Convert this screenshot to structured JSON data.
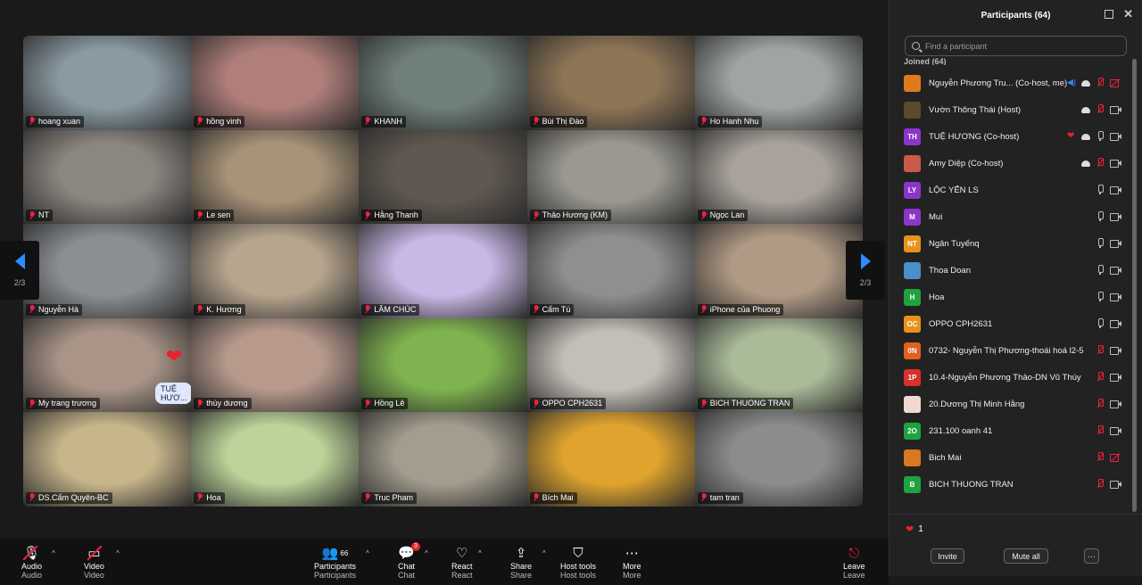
{
  "stage": {
    "pager_left": {
      "page": "2/3"
    },
    "pager_right": {
      "page": "2/3"
    },
    "tiles": [
      {
        "name": "hoang xuan",
        "bg": "#8a9aa3"
      },
      {
        "name": "hồng vinh",
        "bg": "#b07f7a"
      },
      {
        "name": "KHANH",
        "bg": "#6f7f7a"
      },
      {
        "name": "Bùi Thị Đào",
        "bg": "#8e7556"
      },
      {
        "name": "Ho Hanh Nhu",
        "bg": "#9fa6a1"
      },
      {
        "name": "NT",
        "bg": "#8c8680"
      },
      {
        "name": "Le sen",
        "bg": "#a89378"
      },
      {
        "name": "Hằng Thanh",
        "bg": "#5f5850"
      },
      {
        "name": "Thảo Hương (KM)",
        "bg": "#9a9891"
      },
      {
        "name": "Ngọc Lan",
        "bg": "#a8a29b"
      },
      {
        "name": "Nguyễn Hà",
        "bg": "#8b8f93"
      },
      {
        "name": "K. Hương",
        "bg": "#b7a58e"
      },
      {
        "name": "LÂM CHÚC",
        "bg": "#c9b8e6"
      },
      {
        "name": "Cẩm Tú",
        "bg": "#8e8f90"
      },
      {
        "name": "iPhone của Phuong",
        "bg": "#b09a85"
      },
      {
        "name": "My trang trương",
        "bg": "#a99487"
      },
      {
        "name": "thùy dương",
        "bg": "#b89a8d"
      },
      {
        "name": "Hồng Lê",
        "bg": "#7fb34f"
      },
      {
        "name": "OPPO CPH2631",
        "bg": "#c3bfb8"
      },
      {
        "name": "BICH THUONG TRAN",
        "bg": "#aabb99"
      },
      {
        "name": "DS.Cẩm Quyên-BC",
        "bg": "#c8b68b"
      },
      {
        "name": "Hoa",
        "bg": "#bcd49a"
      },
      {
        "name": "Truc Pham",
        "bg": "#a39d8e"
      },
      {
        "name": "Bích Mai",
        "bg": "#e0a42e"
      },
      {
        "name": "tam tran",
        "bg": "#8c8c8f"
      }
    ],
    "speaking_tag": "TUỆ HƯƠ..."
  },
  "panel": {
    "title": "Participants (64)",
    "search_placeholder": "Find a participant",
    "joined_label": "Joined (64)",
    "participants": [
      {
        "initials": "",
        "color": "#e07b1c",
        "name": "Nguyễn Phương Tru... (Co-host, me)"
      },
      {
        "initials": "",
        "color": "#5a4a2a",
        "name": "Vườn Thông Thái (Host)"
      },
      {
        "initials": "TH",
        "color": "#8b35c9",
        "name": "TUỆ HƯƠNG (Co-host)"
      },
      {
        "initials": "",
        "color": "#c95a4a",
        "name": "Amy Diệp (Co-host)"
      },
      {
        "initials": "LY",
        "color": "#8b35c9",
        "name": "LỘC YẾN LS"
      },
      {
        "initials": "M",
        "color": "#8b35c9",
        "name": "Mui"
      },
      {
        "initials": "NT",
        "color": "#e8921c",
        "name": "Ngân Tuyếnq"
      },
      {
        "initials": "",
        "color": "#4a8fc9",
        "name": "Thoa Doan"
      },
      {
        "initials": "H",
        "color": "#1fa33f",
        "name": "Hoa"
      },
      {
        "initials": "OC",
        "color": "#e8921c",
        "name": "OPPO CPH2631"
      },
      {
        "initials": "0N",
        "color": "#e06020",
        "name": "0732- Nguyễn Thị Phương-thoái hoá l2-5"
      },
      {
        "initials": "1P",
        "color": "#d9302a",
        "name": "10.4-Nguyễn Phương Thảo-DN Vũ Thúy"
      },
      {
        "initials": "",
        "color": "#f1d9cf",
        "name": "20.Dương Thị Minh Hằng"
      },
      {
        "initials": "2O",
        "color": "#1fa33f",
        "name": "231.100 oanh 41"
      },
      {
        "initials": "",
        "color": "#d8781f",
        "name": "Bich Mai"
      },
      {
        "initials": "B",
        "color": "#1fa33f",
        "name": "BICH THUONG TRAN"
      }
    ],
    "reaction_count": "1",
    "invite_label": "Invite",
    "mute_all_label": "Mute all",
    "more_label": "···"
  },
  "toolbar": {
    "audio": "Audio",
    "video": "Video",
    "participants": "Participants",
    "participants_count": "66",
    "chat": "Chat",
    "chat_badge": "3",
    "react": "React",
    "share": "Share",
    "host_tools": "Host tools",
    "more": "More",
    "leave": "Leave"
  }
}
